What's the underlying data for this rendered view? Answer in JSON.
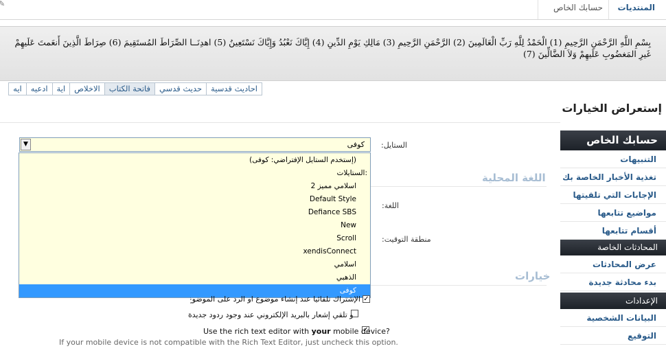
{
  "breadcrumb": {
    "forums": "المنتديات",
    "account": "حسابك الخاص"
  },
  "verse": {
    "text": "بِسْمِ اللَّهِ الرَّحْمَنِ الرَّحِيمِ (1) الْحَمْدُ لِلَّهِ رَبِّ الْعَالَمِينَ (2) الرَّحْمَنِ الرَّحِيمِ (3) مَالِكِ يَوْمِ الدِّينِ (4) إِيَّاكَ نَعْبُدُ وَإِيَّاكَ نَسْتَعِينُ (5) اهدِنَــا الصِّرَاطَ المُستَقِيمَ (6) صِرَاطَ الَّذِينَ أَنعَمتَ عَلَيهِمْ غَيرِ المَغضُوبِ عَلَيهِمْ وَلاَ الضَّالِّينَ (7)"
  },
  "tabs": [
    {
      "label": "احاديث قدسية",
      "active": false
    },
    {
      "label": "حديث قدسي",
      "active": false
    },
    {
      "label": "فاتحة الكتاب",
      "active": true
    },
    {
      "label": "الاخلاص",
      "active": false
    },
    {
      "label": "اية",
      "active": false
    },
    {
      "label": "ادعيه",
      "active": false
    },
    {
      "label": "ايه",
      "active": false
    }
  ],
  "page_title": "إستعراض الخيارات",
  "sidebar": {
    "account_header": "حسابك الخاص",
    "account_items": [
      "التنبيهات",
      "تغذية الأخبار الخاصة بك",
      "الإجابات التي تلقيتها",
      "مواضيع تتابعها",
      "أقسام تتابعها"
    ],
    "conversations_header": "المحادثات الخاصة",
    "conversations_items": [
      "عرض المحادثات",
      "بدء محادثة جديدة"
    ],
    "settings_header": "الإعدادات",
    "settings_items": [
      "البيانات الشخصية",
      "التوقيع"
    ]
  },
  "form": {
    "style_label": "الستايل:",
    "style_value": "كوفى",
    "section_locale": "اللغة المحلية",
    "language_label": "اللغة:",
    "timezone_label": "منطقة التوقيت:",
    "section_options": "خيارات",
    "dropdown_options": [
      {
        "label": "(إستخدم الستايل الإفتراضي: كوفى)",
        "type": "option",
        "selected": false
      },
      {
        "label": "الستايلات:",
        "type": "group",
        "selected": false
      },
      {
        "label": "2 اسلامي مميز",
        "type": "option",
        "selected": false
      },
      {
        "label": "Default Style",
        "type": "option",
        "selected": false
      },
      {
        "label": "Defiance SBS",
        "type": "option",
        "selected": false
      },
      {
        "label": "New",
        "type": "option",
        "selected": false
      },
      {
        "label": "Scroll",
        "type": "option",
        "selected": false
      },
      {
        "label": "xendisConnect",
        "type": "option",
        "selected": false
      },
      {
        "label": "اسلامي",
        "type": "option",
        "selected": false
      },
      {
        "label": "الذهبي",
        "type": "option",
        "selected": false
      },
      {
        "label": "كوفى",
        "type": "option",
        "selected": true
      }
    ],
    "checkboxes": {
      "auto_watch": {
        "label": "الإشتراك تلقائيا عند إنشاء موضوع او الرد على الموضوع...",
        "checked": true
      },
      "email_notify": {
        "label": "و تلقي إشعار بالبريد الإلكتروني عند وجود ردود جديدة",
        "checked": false
      },
      "rich_editor": {
        "label_before": "Use the rich text editor with ",
        "label_bold": "your",
        "label_after": " mobile device?",
        "checked": true
      }
    },
    "rich_editor_note": "If your mobile device is not compatible with the Rich Text Editor, just uncheck this option."
  },
  "colors": {
    "link": "#2a5b8a",
    "section_title": "#a7bdd3",
    "dropdown_bg": "#ffffe0",
    "selected_option": "#3399ff",
    "sidebar_header": "#1d2228"
  }
}
